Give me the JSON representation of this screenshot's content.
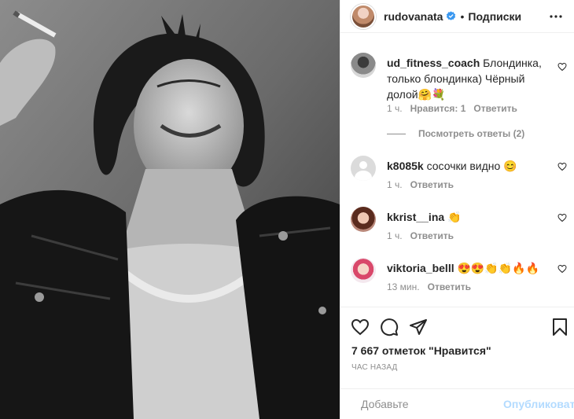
{
  "post": {
    "author": "rudovanata",
    "follow_label": "Подписки",
    "icons": {
      "verified": "verified-badge-icon",
      "more": "more-options-icon"
    }
  },
  "comments": [
    {
      "user": "ud_fitness_coach",
      "text": "Блондинка, только блондинка) Чёрный долой🤗💐",
      "time": "1 ч.",
      "likes": "Нравится: 1",
      "reply": "Ответить",
      "view_replies": "Посмотреть ответы (2)"
    },
    {
      "user": "k8085k",
      "text": "сосочки видно 😊",
      "time": "1 ч.",
      "reply": "Ответить"
    },
    {
      "user": "kkrist__ina",
      "text": "👏",
      "time": "1 ч.",
      "reply": "Ответить"
    },
    {
      "user": "viktoria_belll",
      "text": "😍😍👏👏🔥🔥",
      "time": "13 мин.",
      "reply": "Ответить"
    }
  ],
  "likes_text": "7 667 отметок \"Нравится\"",
  "timestamp": "ЧАС НАЗАД",
  "add_comment": {
    "placeholder": "Добавьте",
    "publish_label": "Опубликовать"
  },
  "colors": {
    "publish_disabled": "#b3dbff",
    "verified": "#3897f0",
    "secondary_text": "#8e8e8e"
  }
}
